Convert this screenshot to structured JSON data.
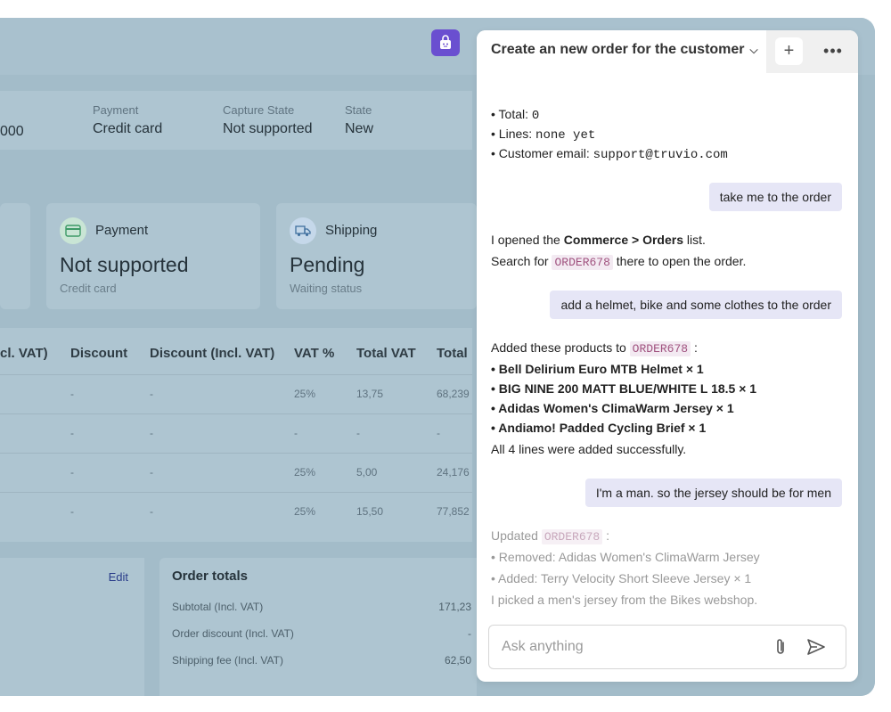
{
  "order_info": [
    {
      "label": "",
      "value": "000"
    },
    {
      "label": "Payment",
      "value": "Credit card"
    },
    {
      "label": "Capture State",
      "value": "Not supported"
    },
    {
      "label": "State",
      "value": "New"
    }
  ],
  "cards": [
    {
      "title": "Payment",
      "value": "Not supported",
      "sub": "Credit card",
      "icon": "credit-card-icon"
    },
    {
      "title": "Shipping",
      "value": "Pending",
      "sub": "Waiting status",
      "icon": "truck-icon"
    }
  ],
  "table": {
    "headers": [
      "cl. VAT)",
      "Discount",
      "Discount (Incl. VAT)",
      "VAT %",
      "Total VAT",
      "Total"
    ],
    "rows": [
      [
        "-",
        "-",
        "25%",
        "13,75",
        "68,239"
      ],
      [
        "-",
        "-",
        "-",
        "-",
        "-"
      ],
      [
        "-",
        "-",
        "25%",
        "5,00",
        "24,176"
      ],
      [
        "-",
        "-",
        "25%",
        "15,50",
        "77,852"
      ]
    ]
  },
  "address": {
    "edit_label": "Edit"
  },
  "totals": {
    "title": "Order totals",
    "rows": [
      {
        "label": "Subtotal (Incl. VAT)",
        "value": "171,23"
      },
      {
        "label": "Order discount (Incl. VAT)",
        "value": "-"
      },
      {
        "label": "Shipping fee (Incl. VAT)",
        "value": "62,50"
      }
    ]
  },
  "chat": {
    "title": "Create an new order for the customer",
    "plus": "+",
    "more": "•••",
    "summary": [
      {
        "label": "Total:",
        "value": "0"
      },
      {
        "label": "Lines:",
        "value": "none yet"
      },
      {
        "label": "Customer email:",
        "value": "support@truvio.com"
      }
    ],
    "user1": "take me to the order",
    "reply1_a_pre": "I opened the ",
    "reply1_a_bold": "Commerce > Orders",
    "reply1_a_post": " list.",
    "reply1_b_pre": "Search for ",
    "reply1_b_code": "ORDER678",
    "reply1_b_post": " there to open the order.",
    "user2": "add a helmet, bike and some clothes to the order",
    "reply2_pre": "Added these products to ",
    "reply2_code": "ORDER678",
    "reply2_post": " :",
    "reply2_items": [
      "Bell Delirium Euro MTB Helmet × 1",
      "BIG NINE 200 MATT BLUE/WHITE L 18.5 × 1",
      "Adidas Women's ClimaWarm Jersey × 1",
      "Andiamo! Padded Cycling Brief × 1"
    ],
    "reply2_footer": "All 4 lines were added successfully.",
    "user3": "I'm a man. so the jersey should be for men",
    "reply3_pre": "Updated ",
    "reply3_code": "ORDER678",
    "reply3_post": " :",
    "reply3_items": [
      "Removed: Adidas Women's ClimaWarm Jersey",
      "Added: Terry Velocity Short Sleeve Jersey × 1"
    ],
    "reply3_footer": "I picked a men's jersey from the Bikes webshop.",
    "input_placeholder": "Ask anything"
  }
}
